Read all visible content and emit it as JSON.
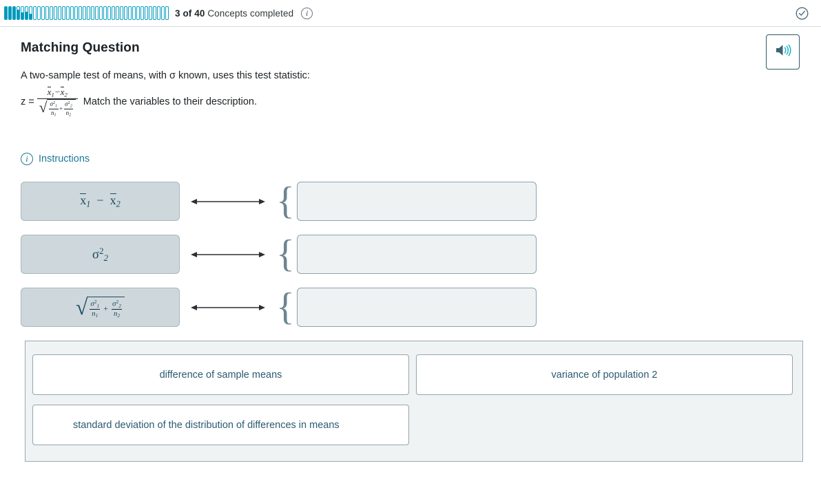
{
  "topbar": {
    "progress_total": 40,
    "progress_completed": 3,
    "progress_count_label": "3 of 40",
    "progress_text": "Concepts completed",
    "info_icon": "info-icon",
    "info_glyph": "i",
    "check_icon": "check-circle-icon"
  },
  "header": {
    "title": "Matching Question",
    "audio_button": "speaker-icon"
  },
  "prompt": {
    "line1": "A two-sample test of means, with σ known, uses this test statistic:",
    "z_label": "z =",
    "formula": {
      "numerator": "x̄1 − x̄2",
      "denominator": "√(σ₁²/n₁ + σ₂²/n₂)",
      "full": "z = (x̄1 − x̄2) / √(σ₁²/n₁ + σ₂²/n₂)"
    },
    "after_formula": "Match the variables to their description."
  },
  "instructions": {
    "label": "Instructions",
    "icon": "info-icon",
    "glyph": "i"
  },
  "match_rows": [
    {
      "term_plain": "x̄1 − x̄2",
      "drop_zone_value": "",
      "connector": "double-arrow"
    },
    {
      "term_plain": "σ₂²",
      "drop_zone_value": "",
      "connector": "double-arrow"
    },
    {
      "term_plain": "√(σ₁²/n₁ + σ₂²/n₂)",
      "drop_zone_value": "",
      "connector": "double-arrow"
    }
  ],
  "answer_bank": [
    {
      "label": "difference of sample means"
    },
    {
      "label": "variance of population 2"
    },
    {
      "label": "standard deviation of the distribution of differences in means"
    }
  ],
  "colors": {
    "accent_teal": "#0697b8",
    "link_teal": "#1d7a96",
    "term_box_fill": "#ced8dc",
    "drop_zone_fill": "#eef2f3",
    "bank_fill": "#eff3f4",
    "text_dark": "#1d2226",
    "answer_text": "#2b5a72"
  }
}
